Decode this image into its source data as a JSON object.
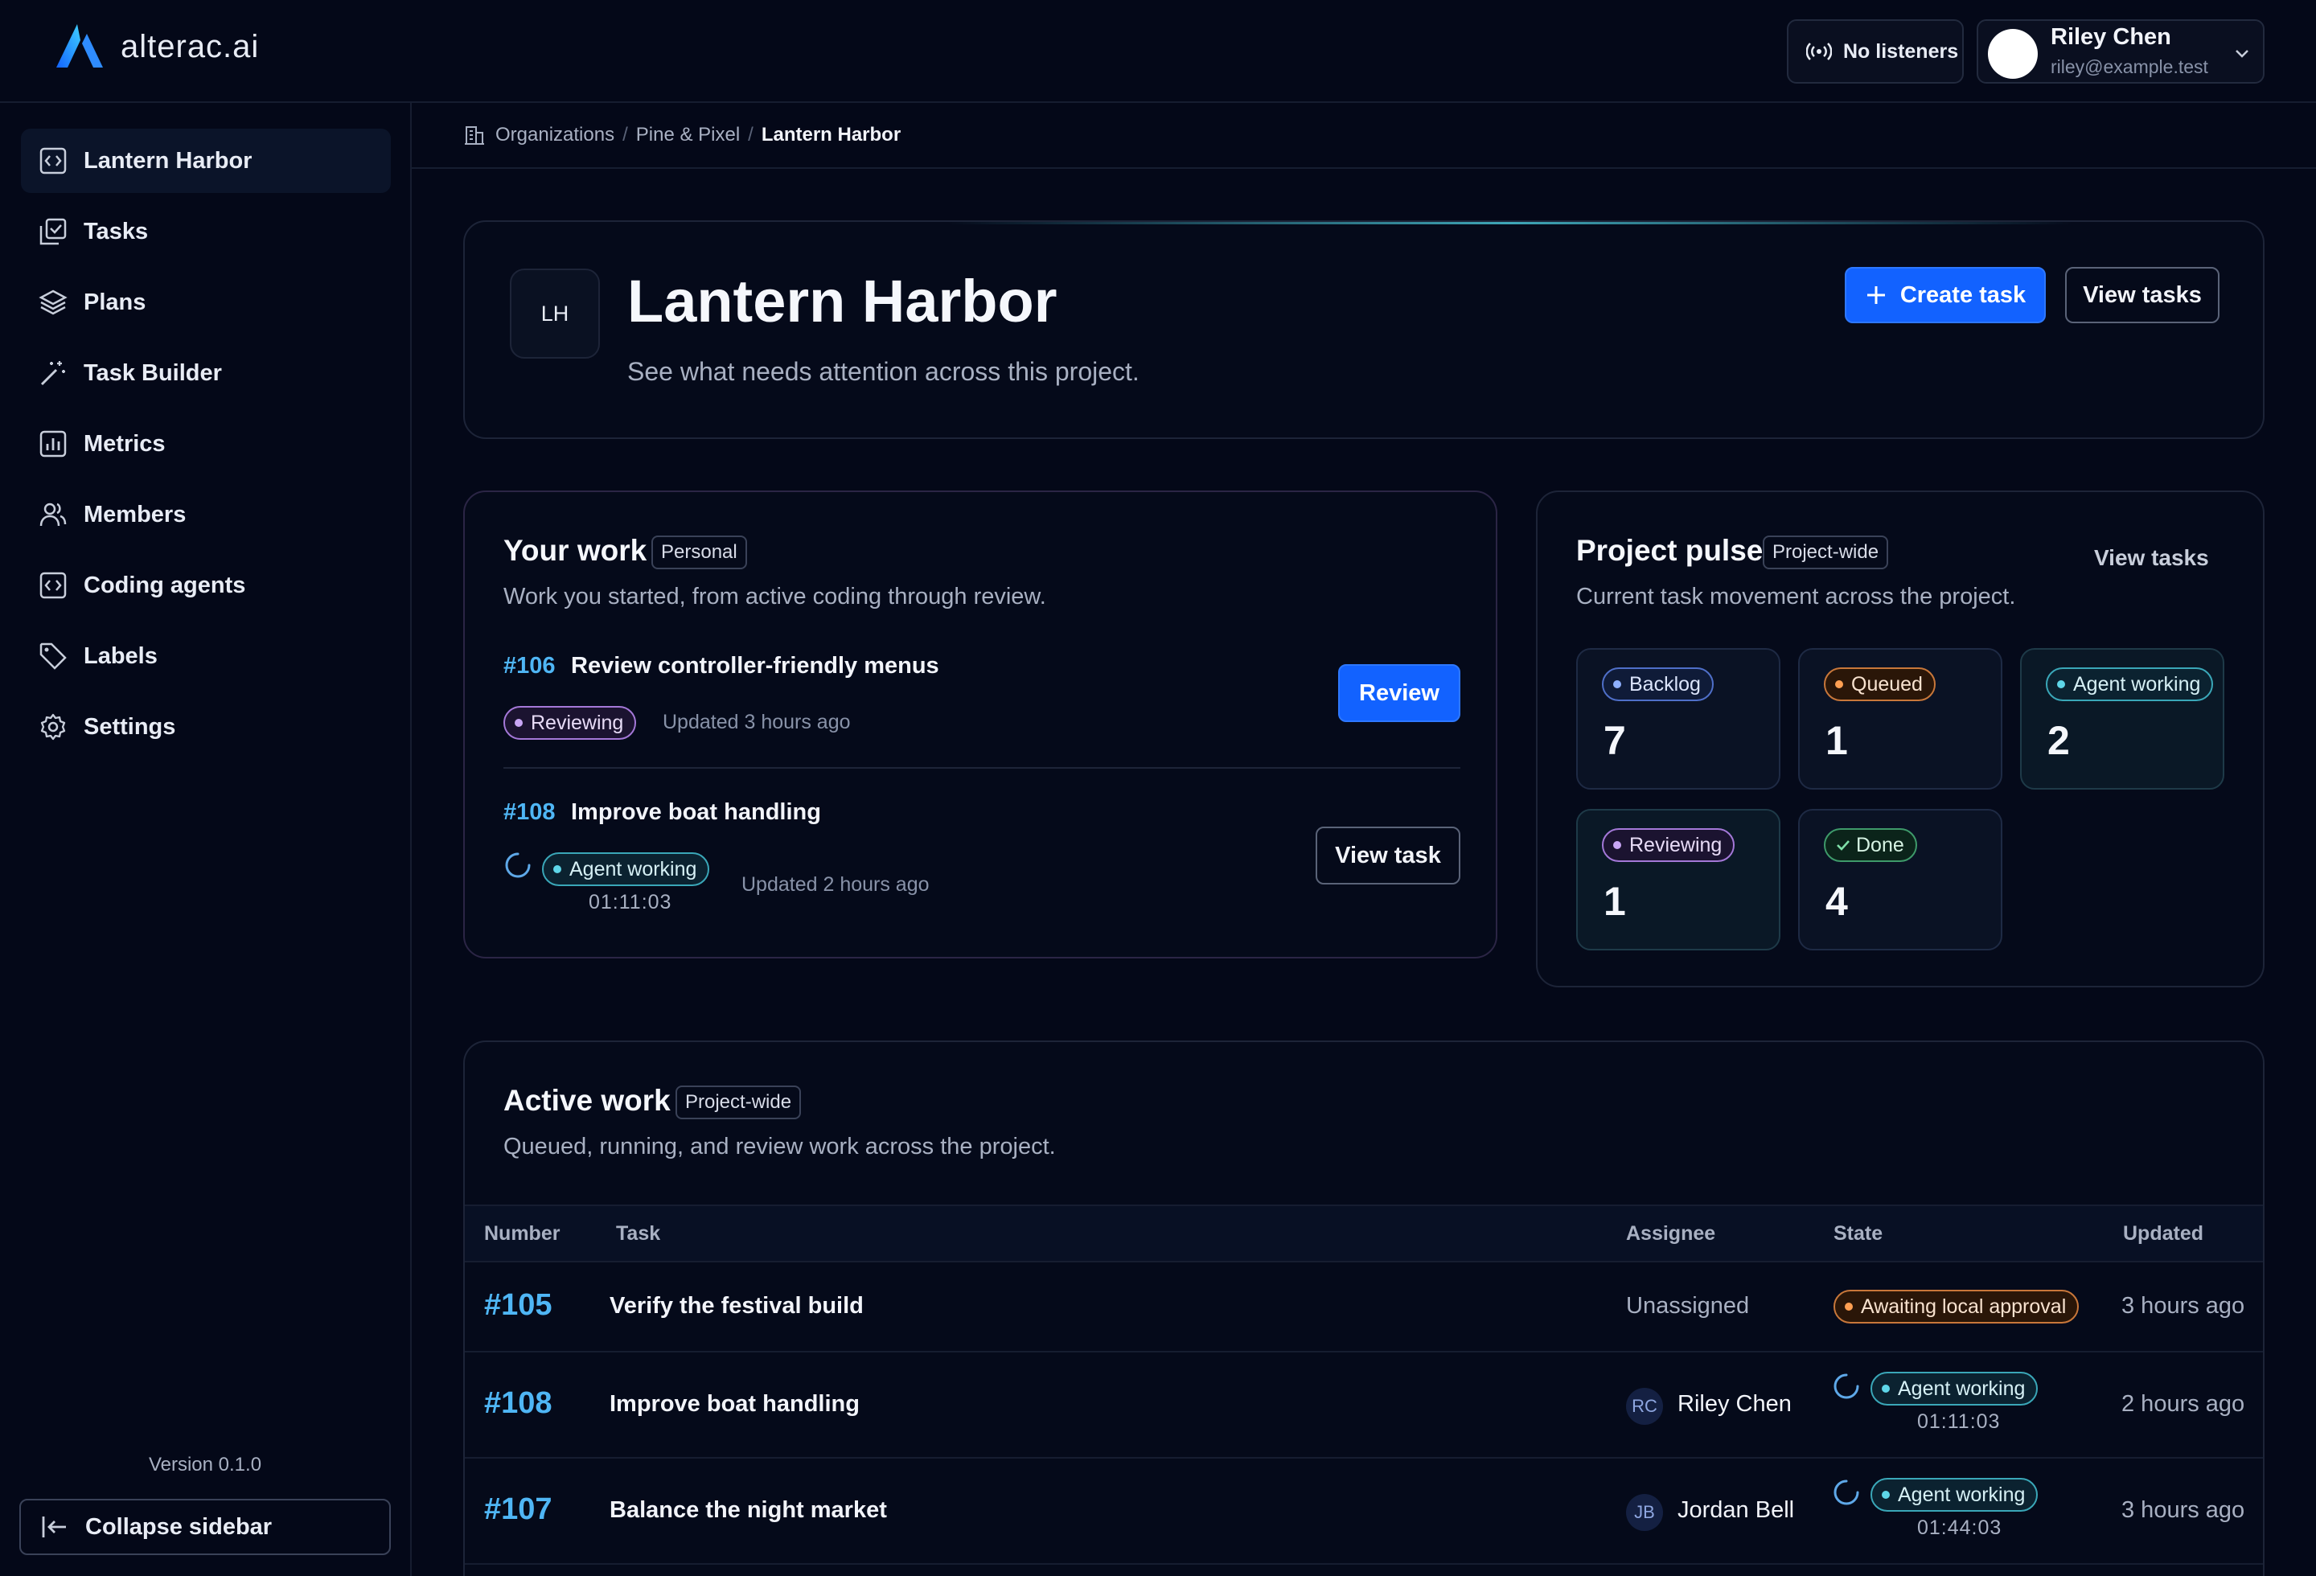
{
  "brand": {
    "name": "alterac.ai"
  },
  "header": {
    "listeners_label": "No listeners",
    "user": {
      "name": "Riley Chen",
      "email": "riley@example.test"
    }
  },
  "sidebar": {
    "items": [
      {
        "label": "Lantern Harbor",
        "icon": "code-box-icon",
        "active": true
      },
      {
        "label": "Tasks",
        "icon": "tasks-icon"
      },
      {
        "label": "Plans",
        "icon": "layers-icon"
      },
      {
        "label": "Task Builder",
        "icon": "magic-wand-icon"
      },
      {
        "label": "Metrics",
        "icon": "bar-chart-icon"
      },
      {
        "label": "Members",
        "icon": "users-icon"
      },
      {
        "label": "Coding agents",
        "icon": "code-box-icon"
      },
      {
        "label": "Labels",
        "icon": "tag-icon"
      },
      {
        "label": "Settings",
        "icon": "gear-icon"
      }
    ],
    "version": "Version 0.1.0",
    "collapse_label": "Collapse sidebar"
  },
  "breadcrumb": {
    "root": "Organizations",
    "org": "Pine & Pixel",
    "current": "Lantern Harbor"
  },
  "hero": {
    "initials": "LH",
    "title": "Lantern Harbor",
    "subtitle": "See what needs attention across this project.",
    "create_label": "Create task",
    "view_label": "View tasks"
  },
  "your_work": {
    "title": "Your work",
    "tag": "Personal",
    "subtitle": "Work you started, from active coding through review.",
    "items": [
      {
        "number": "#106",
        "name": "Review controller-friendly menus",
        "state": "Reviewing",
        "updated": "Updated 3 hours ago",
        "action": "Review"
      },
      {
        "number": "#108",
        "name": "Improve boat handling",
        "state": "Agent working",
        "timer": "01:11:03",
        "updated": "Updated 2 hours ago",
        "action": "View task"
      }
    ]
  },
  "pulse": {
    "title": "Project pulse",
    "tag": "Project-wide",
    "link": "View tasks",
    "subtitle": "Current task movement across the project.",
    "stats": [
      {
        "label": "Backlog",
        "value": "7"
      },
      {
        "label": "Queued",
        "value": "1"
      },
      {
        "label": "Agent working",
        "value": "2"
      },
      {
        "label": "Reviewing",
        "value": "1"
      },
      {
        "label": "Done",
        "value": "4"
      }
    ]
  },
  "active_work": {
    "title": "Active work",
    "tag": "Project-wide",
    "subtitle": "Queued, running, and review work across the project.",
    "columns": [
      "Number",
      "Task",
      "Assignee",
      "State",
      "Updated"
    ],
    "rows": [
      {
        "number": "#105",
        "task": "Verify the festival build",
        "assignee": "Unassigned",
        "initials": "",
        "state": "Awaiting local approval",
        "timer": "",
        "updated": "3 hours ago"
      },
      {
        "number": "#108",
        "task": "Improve boat handling",
        "assignee": "Riley Chen",
        "initials": "RC",
        "state": "Agent working",
        "timer": "01:11:03",
        "updated": "2 hours ago"
      },
      {
        "number": "#107",
        "task": "Balance the night market",
        "assignee": "Jordan Bell",
        "initials": "JB",
        "state": "Agent working",
        "timer": "01:44:03",
        "updated": "3 hours ago"
      }
    ]
  },
  "colors": {
    "accent": "#1262ff",
    "link": "#4fb6f5",
    "background": "#040818"
  }
}
